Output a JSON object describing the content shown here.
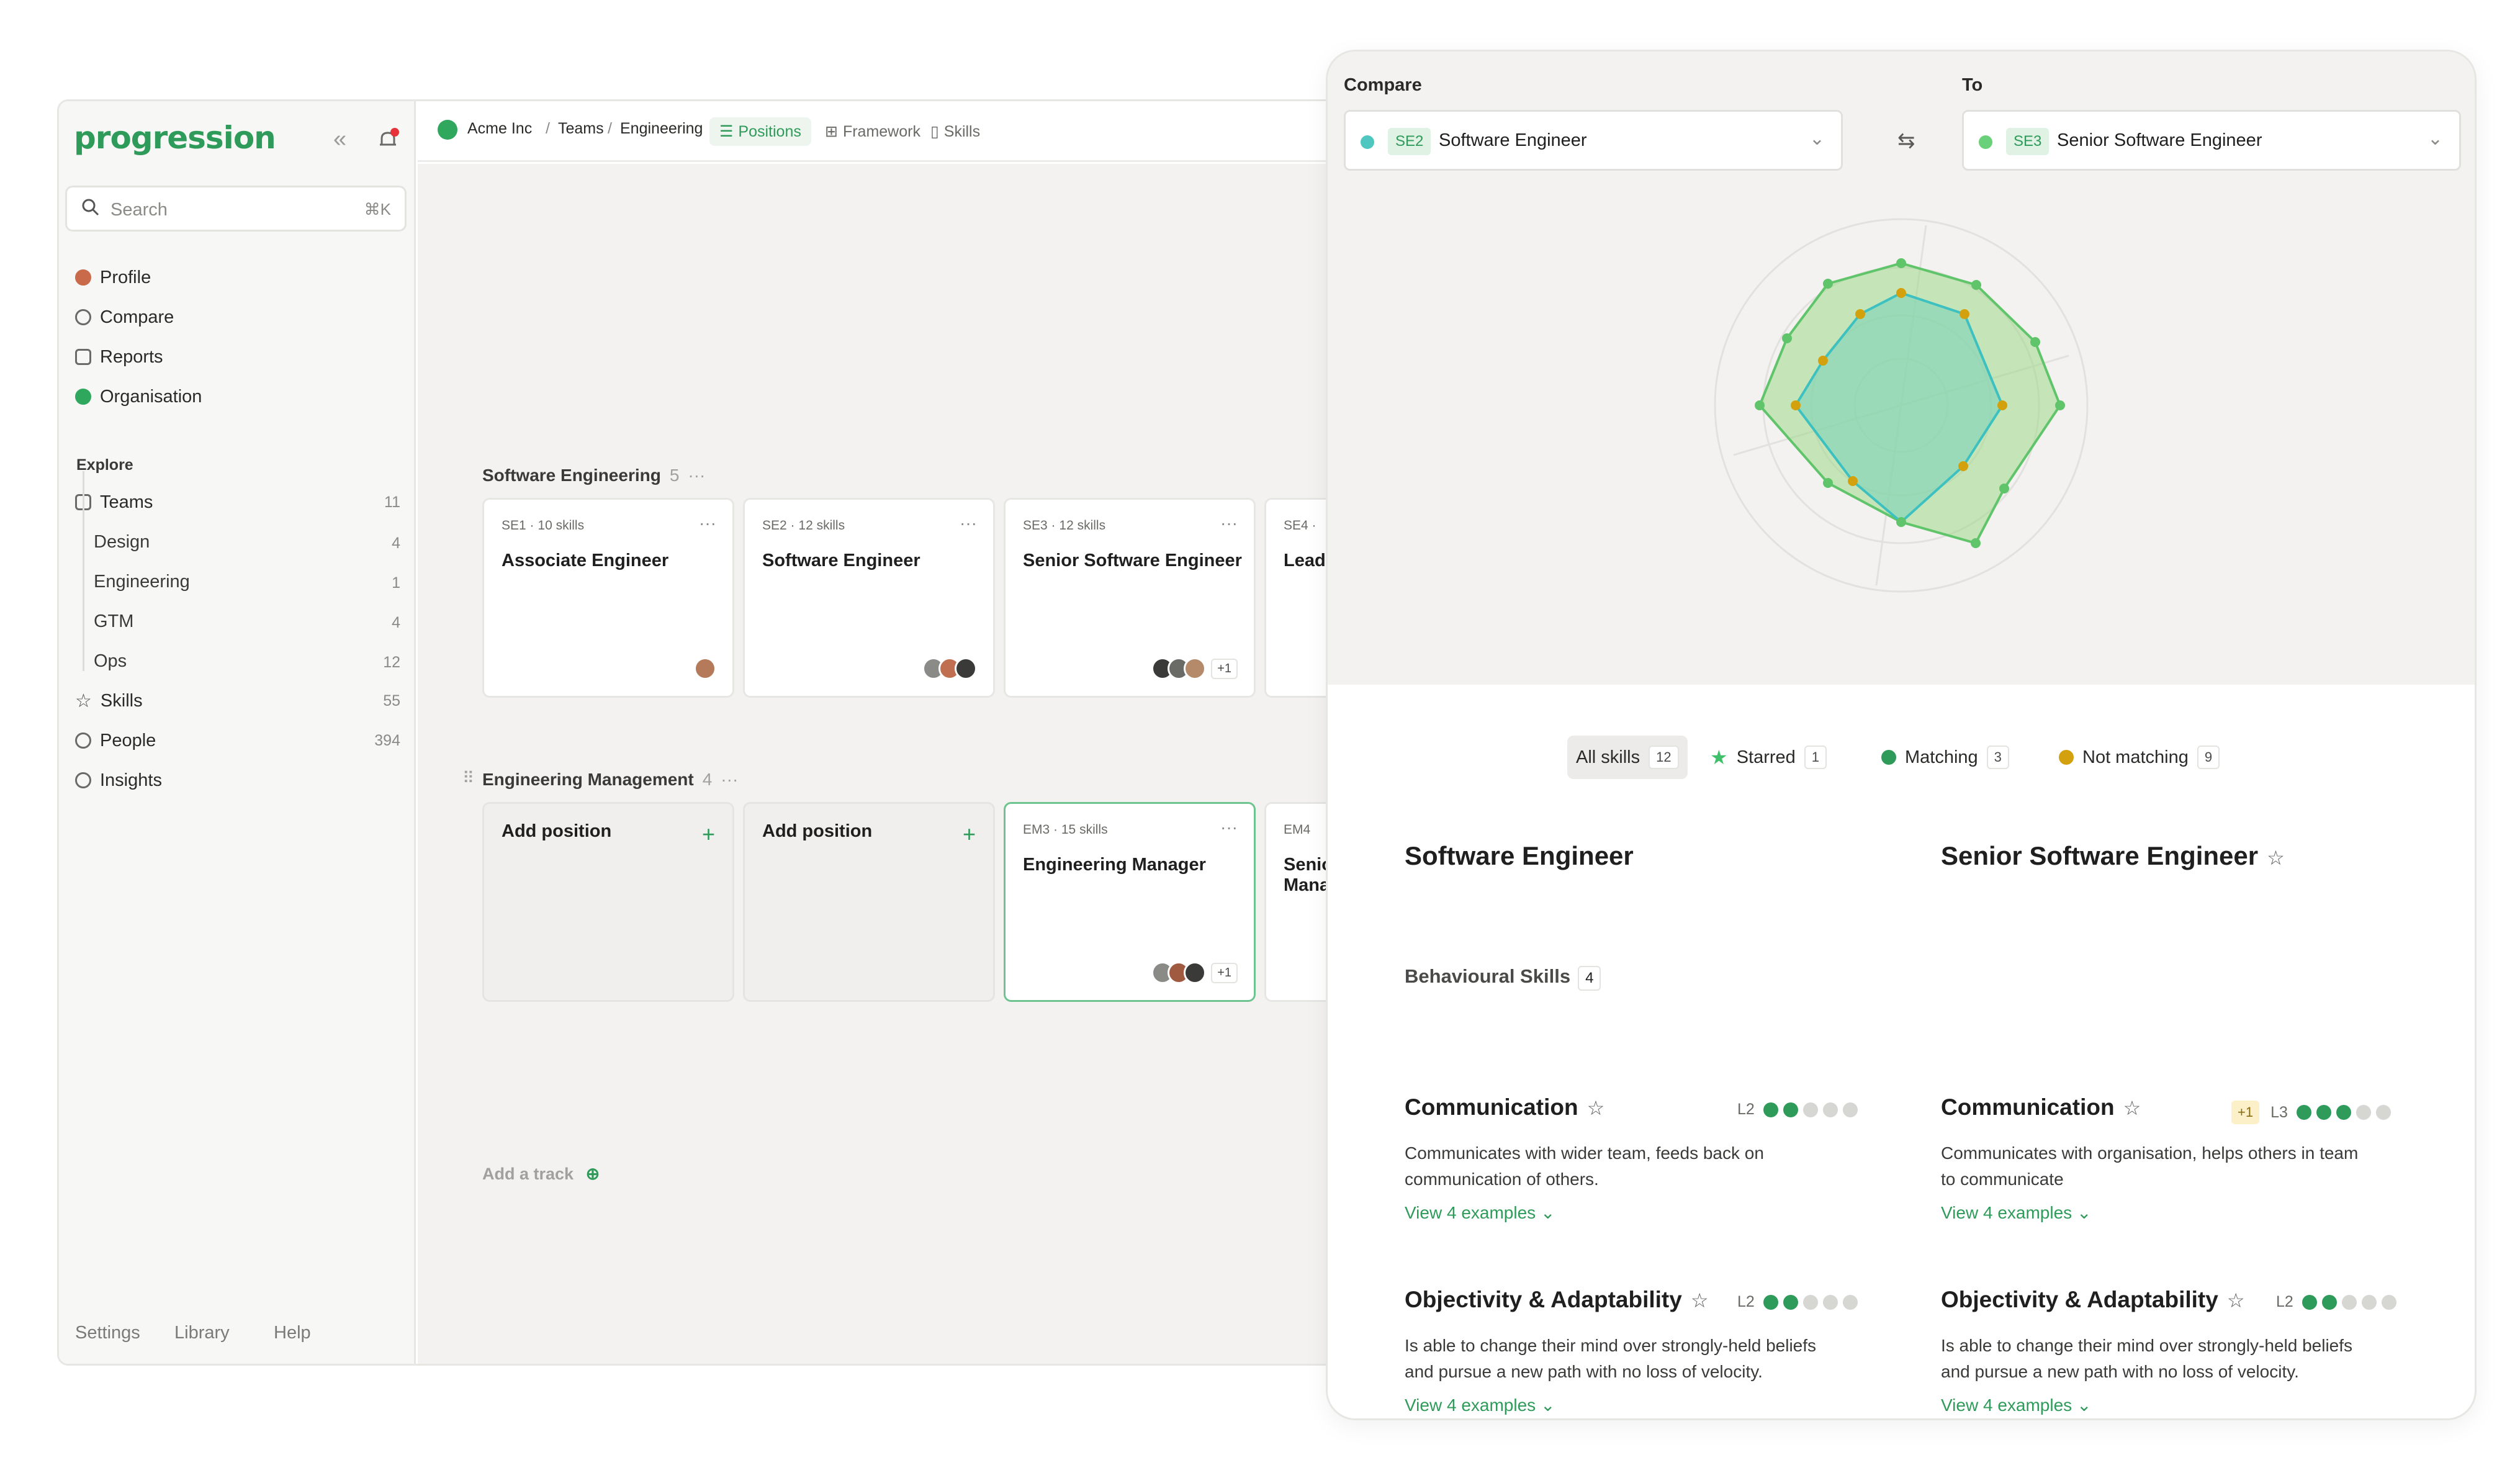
{
  "app": {
    "logo": "progression",
    "search_placeholder": "Search",
    "search_shortcut": "⌘K",
    "nav": [
      {
        "label": "Profile",
        "icon": "profile-icon"
      },
      {
        "label": "Compare",
        "icon": "compare-icon"
      },
      {
        "label": "Reports",
        "icon": "reports-icon"
      },
      {
        "label": "Organisation",
        "icon": "organisation-icon"
      }
    ],
    "explore_label": "Explore",
    "teams": {
      "label": "Teams",
      "count": "11"
    },
    "team_items": [
      {
        "label": "Design",
        "count": "4"
      },
      {
        "label": "Engineering",
        "count": "1"
      },
      {
        "label": "GTM",
        "count": "4"
      },
      {
        "label": "Ops",
        "count": "12"
      }
    ],
    "skills": {
      "label": "Skills",
      "count": "55"
    },
    "people": {
      "label": "People",
      "count": "394"
    },
    "insights": {
      "label": "Insights"
    },
    "footer": [
      "Settings",
      "Library",
      "Help"
    ]
  },
  "topbar": {
    "org": "Acme Inc",
    "sep1": "/",
    "teams": "Teams",
    "sep2": "/",
    "team": "Engineering",
    "tabs": [
      "Positions",
      "Framework",
      "Skills"
    ]
  },
  "board": {
    "track1": {
      "title": "Software Engineering",
      "count": "5",
      "more": "···"
    },
    "track1_cards": [
      {
        "code": "SE1",
        "sep": "·",
        "skills": "10 skills",
        "title": "Associate Engineer"
      },
      {
        "code": "SE2",
        "sep": "·",
        "skills": "12 skills",
        "title": "Software Engineer"
      },
      {
        "code": "SE3",
        "sep": "·",
        "skills": "12 skills",
        "title": "Senior Software Engineer",
        "extra": "+1"
      },
      {
        "code": "SE4",
        "sep": "·",
        "title": "Lead"
      }
    ],
    "track2": {
      "title": "Engineering Management",
      "count": "4",
      "more": "···"
    },
    "track2_cards": [
      {
        "title": "Add position"
      },
      {
        "title": "Add position"
      },
      {
        "code": "EM3",
        "sep": "·",
        "skills": "15 skills",
        "title": "Engineering Manager",
        "extra": "+1"
      },
      {
        "code": "EM4",
        "title_line1": "Senio",
        "title_line2": "Mana"
      }
    ],
    "add_track": "Add a track"
  },
  "compare": {
    "compare_label": "Compare",
    "to_label": "To",
    "left": {
      "code": "SE2",
      "name": "Software Engineer",
      "color": "#4fc6c0"
    },
    "right": {
      "code": "SE3",
      "name": "Senior Software Engineer",
      "color": "#6ad07a"
    },
    "filters": [
      {
        "label": "All skills",
        "count": "12"
      },
      {
        "label": "Starred",
        "count": "1"
      },
      {
        "label": "Matching",
        "count": "3"
      },
      {
        "label": "Not matching",
        "count": "9"
      }
    ],
    "colors": {
      "matching": "#2f9b5a",
      "not_matching": "#d4a10e",
      "starred": "#3fbf6a"
    },
    "left_title": "Software Engineer",
    "right_title": "Senior Software Engineer",
    "category": {
      "label": "Behavioural Skills",
      "count": "4"
    },
    "skills": [
      {
        "name": "Communication",
        "left": {
          "level": "L2",
          "filled": 2,
          "desc": "Communicates with wider team, feeds back on communication of others.",
          "link": "View 4 examples"
        },
        "right": {
          "delta": "+1",
          "level": "L3",
          "filled": 3,
          "desc": "Communicates with organisation, helps others in team to communicate",
          "link": "View 4 examples"
        }
      },
      {
        "name": "Objectivity & Adaptability",
        "left": {
          "level": "L2",
          "filled": 2,
          "desc": "Is able to change their mind over strongly-held beliefs and pursue a new path with no loss of velocity.",
          "link": "View 4 examples"
        },
        "right": {
          "level": "L2",
          "filled": 2,
          "desc": "Is able to change their mind over strongly-held beliefs and pursue a new path with no loss of velocity.",
          "link": "View 4 examples"
        }
      }
    ]
  }
}
